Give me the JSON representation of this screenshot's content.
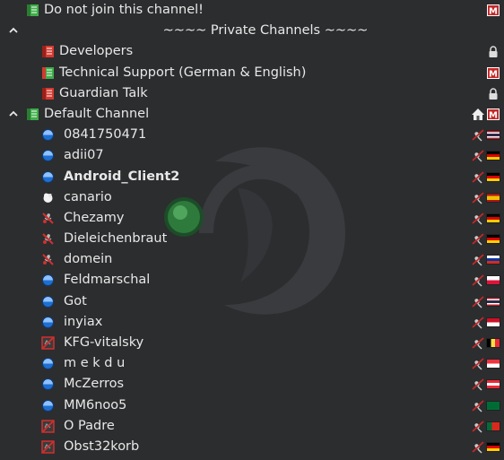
{
  "channels": {
    "no_join": {
      "label": "Do not join this channel!"
    },
    "private_spacer": {
      "label": "~~~~ Private Channels ~~~~"
    },
    "developers": {
      "label": "Developers"
    },
    "tech_support": {
      "label": "Technical Support (German & English)"
    },
    "guardian_talk": {
      "label": "Guardian Talk"
    },
    "default_channel": {
      "label": "Default Channel"
    }
  },
  "users": [
    {
      "name": "0841750471",
      "status": "blue",
      "flag": "th"
    },
    {
      "name": "adii07",
      "status": "blue",
      "flag": "de"
    },
    {
      "name": "Android_Client2",
      "status": "blue",
      "flag": "de",
      "bold": true
    },
    {
      "name": "canario",
      "status": "away",
      "flag": "es"
    },
    {
      "name": "Chezamy",
      "status": "mic-muted",
      "flag": "de"
    },
    {
      "name": "Dieleichenbraut",
      "status": "mic-muted",
      "flag": "de"
    },
    {
      "name": "domein",
      "status": "mic-muted",
      "flag": "ru"
    },
    {
      "name": "Feldmarschal",
      "status": "blue",
      "flag": "pl"
    },
    {
      "name": "Got",
      "status": "blue",
      "flag": "th"
    },
    {
      "name": "inyiax",
      "status": "blue",
      "flag": "id"
    },
    {
      "name": "KFG-vitalsky",
      "status": "output-muted",
      "flag": "be"
    },
    {
      "name": "m e k d u",
      "status": "blue",
      "flag": "sg"
    },
    {
      "name": "McZerros",
      "status": "blue",
      "flag": "at"
    },
    {
      "name": "MM6noo5",
      "status": "blue",
      "flag": "sa"
    },
    {
      "name": "O Padre",
      "status": "output-muted",
      "flag": "pt"
    },
    {
      "name": "Obst32korb",
      "status": "output-muted",
      "flag": "de"
    }
  ],
  "colors": {
    "background": "#2c2d2f",
    "text": "#e8e8e8",
    "channel_icon_green": "#3fae49",
    "channel_icon_red": "#d43a2f",
    "moderated_badge": "#c62828",
    "talk_blue": "#1f6fd1"
  }
}
